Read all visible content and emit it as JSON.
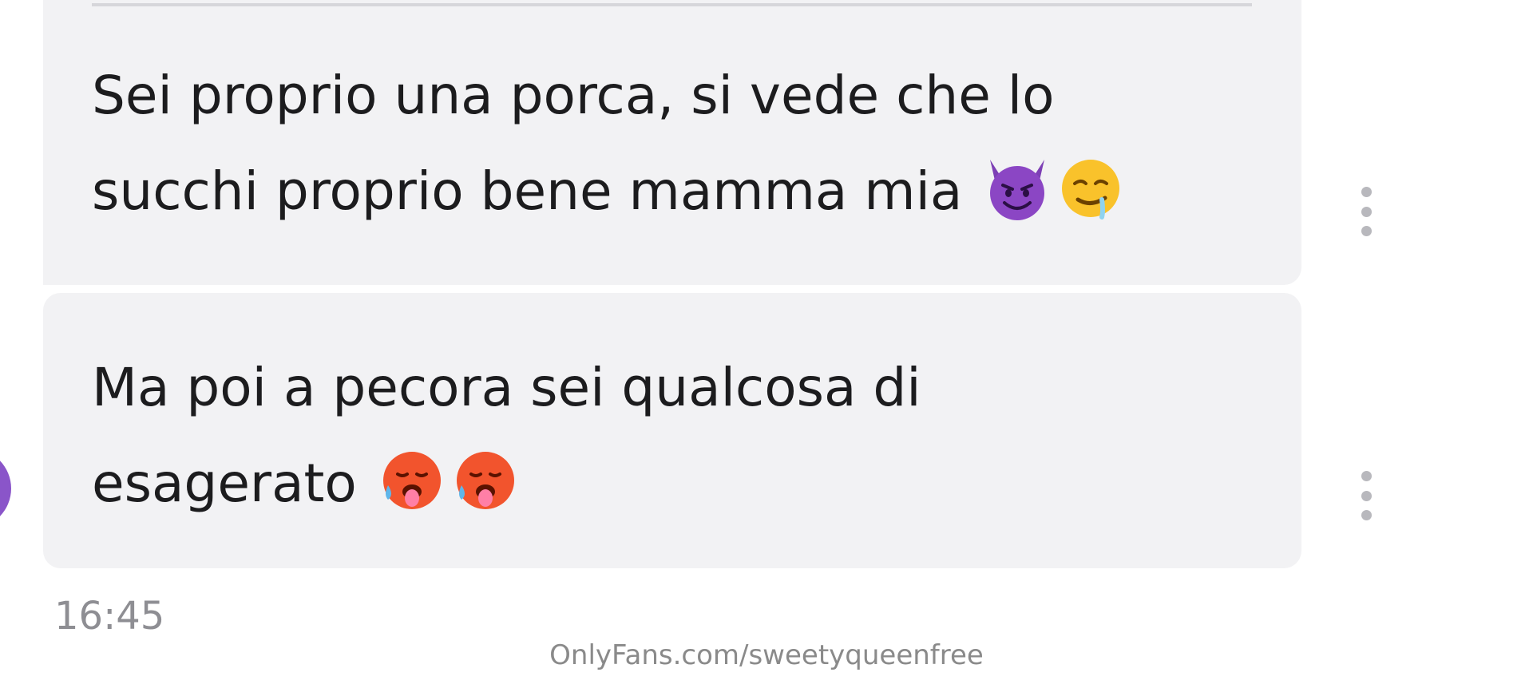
{
  "messages": [
    {
      "line1": "Sei proprio una porca, si vede che lo",
      "line2": "succhi proprio bene mamma mia",
      "emojis": [
        "smiling-devil-icon",
        "drooling-face-icon"
      ]
    },
    {
      "line1": "Ma poi a pecora sei qualcosa di",
      "line2": "esagerato",
      "emojis": [
        "hot-face-icon",
        "hot-face-icon"
      ]
    }
  ],
  "timestamp": "16:45",
  "watermark": "OnlyFans.com/sweetyqueenfree",
  "colors": {
    "bubble_bg": "#f2f2f4",
    "text": "#1c1c1e",
    "timestamp": "#8e8e93",
    "avatar": "#8a55c9",
    "menu_dots": "#b8b8bd"
  }
}
